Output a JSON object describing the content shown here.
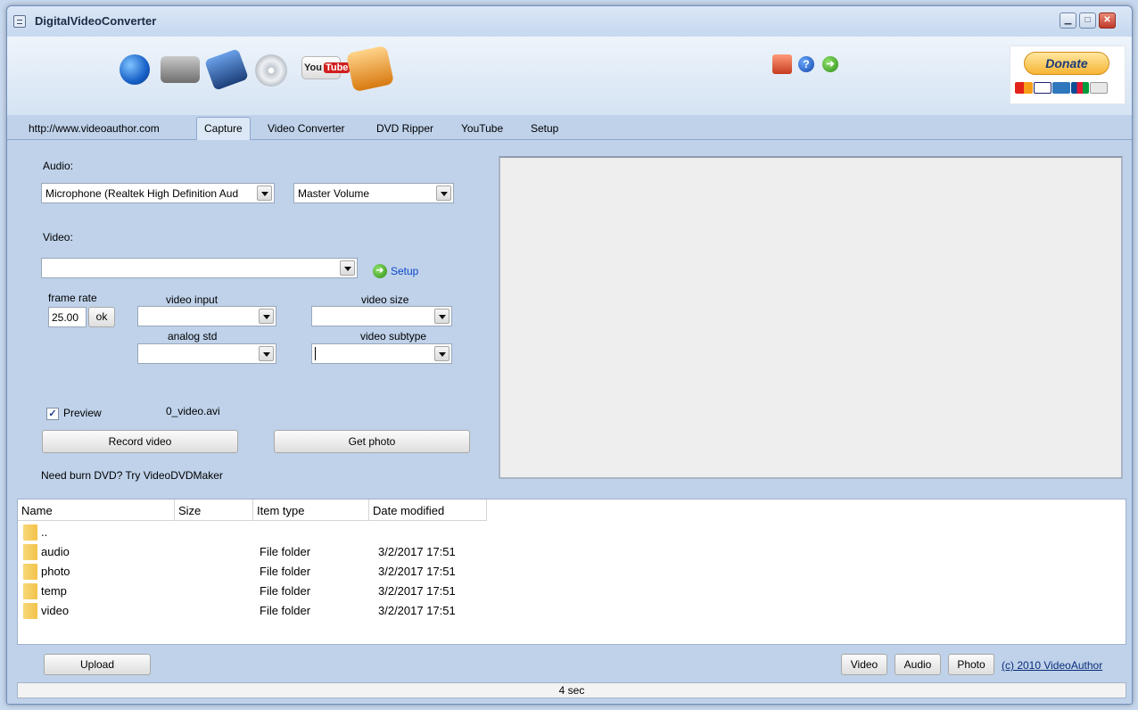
{
  "window": {
    "title": "DigitalVideoConverter"
  },
  "toolbar": {
    "icons": [
      "globe-icon",
      "video-camera-icon",
      "film-icon",
      "disc-icon",
      "youtube-icon",
      "convert-icon",
      "home-icon",
      "help-icon",
      "next-icon"
    ],
    "youtube_you": "You",
    "youtube_tube": "Tube",
    "help_glyph": "?",
    "next_glyph": "➔"
  },
  "donate": {
    "label": "Donate"
  },
  "tabs": [
    {
      "label": "http://www.videoauthor.com"
    },
    {
      "label": "Capture",
      "active": true
    },
    {
      "label": "Video Converter"
    },
    {
      "label": "DVD Ripper"
    },
    {
      "label": "YouTube"
    },
    {
      "label": "Setup"
    }
  ],
  "capture": {
    "audio_label": "Audio:",
    "audio_device": "Microphone (Realtek High Definition Aud",
    "audio_mixer": "Master Volume",
    "video_label": "Video:",
    "video_device": "",
    "setup_link": "Setup",
    "frame_rate_label": "frame rate",
    "frame_rate_value": "25.00",
    "ok_label": "ok",
    "video_input_label": "video input",
    "video_input_value": "",
    "video_size_label": "video size",
    "video_size_value": "",
    "analog_std_label": "analog std",
    "analog_std_value": "",
    "video_subtype_label": "video subtype",
    "video_subtype_value": "",
    "preview_label": "Preview",
    "preview_checked": true,
    "filename": "0_video.avi",
    "record_button": "Record video",
    "photo_button": "Get photo",
    "burn_hint": "Need burn DVD? Try VideoDVDMaker"
  },
  "filelist": {
    "columns": [
      "Name",
      "Size",
      "Item type",
      "Date modified"
    ],
    "rows": [
      {
        "name": "..",
        "type": "",
        "date": ""
      },
      {
        "name": "audio",
        "type": "File folder",
        "date": "3/2/2017 17:51"
      },
      {
        "name": "photo",
        "type": "File folder",
        "date": "3/2/2017 17:51"
      },
      {
        "name": "temp",
        "type": "File folder",
        "date": "3/2/2017 17:51"
      },
      {
        "name": "video",
        "type": "File folder",
        "date": "3/2/2017 17:51"
      }
    ]
  },
  "bottom": {
    "upload_button": "Upload",
    "filter_video": "Video",
    "filter_audio": "Audio",
    "filter_photo": "Photo",
    "copyright": "(c) 2010 VideoAuthor"
  },
  "status": {
    "text": "4 sec"
  },
  "colors": {
    "accent": "#bfd2ea",
    "link": "#0b46c9",
    "folder": "#f3c24a"
  }
}
